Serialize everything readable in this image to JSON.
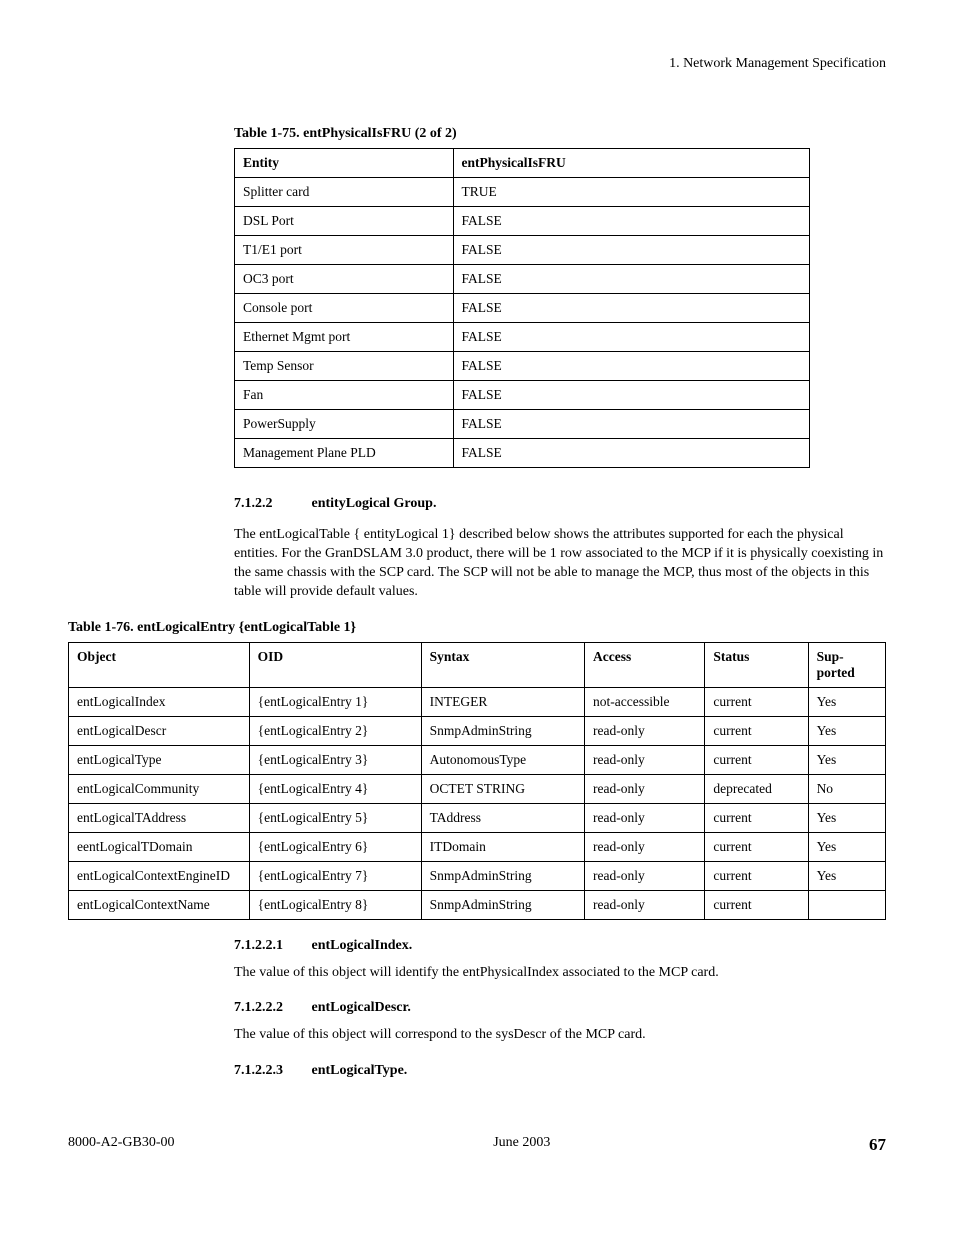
{
  "header": {
    "chapter": "1. Network Management Specification"
  },
  "table175": {
    "caption": "Table 1-75.  entPhysicalIsFRU (2 of 2)",
    "headers": [
      "Entity",
      "entPhysicalIsFRU"
    ],
    "rows": [
      [
        "Splitter card",
        "TRUE"
      ],
      [
        "DSL Port",
        "FALSE"
      ],
      [
        "T1/E1 port",
        "FALSE"
      ],
      [
        "OC3 port",
        "FALSE"
      ],
      [
        "Console port",
        "FALSE"
      ],
      [
        "Ethernet Mgmt port",
        "FALSE"
      ],
      [
        "Temp Sensor",
        "FALSE"
      ],
      [
        "Fan",
        "FALSE"
      ],
      [
        "PowerSupply",
        "FALSE"
      ],
      [
        "Management Plane PLD",
        "FALSE"
      ]
    ]
  },
  "section7122": {
    "number": "7.1.2.2",
    "title": "entityLogical Group.",
    "body": "The entLogicalTable { entityLogical 1} described below shows the attributes supported for each the physical entities. For the GranDSLAM 3.0 product, there will be 1 row associated to the MCP if it is physically coexisting in the same chassis with the SCP card. The SCP will not be able to manage the MCP, thus most of the objects in this table will provide default values."
  },
  "table176": {
    "caption": "Table 1-76.  entLogicalEntry {entLogicalTable 1}",
    "headers": [
      "Object",
      "OID",
      "Syntax",
      "Access",
      "Status",
      "Sup-ported"
    ],
    "rows": [
      [
        "entLogicalIndex",
        "{entLogicalEntry 1}",
        "INTEGER",
        "not-accessible",
        "current",
        "Yes"
      ],
      [
        "entLogicalDescr",
        "{entLogicalEntry 2}",
        "SnmpAdminString",
        "read-only",
        "current",
        "Yes"
      ],
      [
        "entLogicalType",
        "{entLogicalEntry 3}",
        "AutonomousType",
        "read-only",
        "current",
        "Yes"
      ],
      [
        "entLogicalCommunity",
        "{entLogicalEntry 4}",
        "OCTET STRING",
        "read-only",
        "deprecated",
        "No"
      ],
      [
        "entLogicalTAddress",
        "{entLogicalEntry 5}",
        "TAddress",
        "read-only",
        "current",
        "Yes"
      ],
      [
        "eentLogicalTDomain",
        "{entLogicalEntry 6}",
        "ITDomain",
        "read-only",
        "current",
        "Yes"
      ],
      [
        "entLogicalContextEngineID",
        "{entLogicalEntry 7}",
        "SnmpAdminString",
        "read-only",
        "current",
        "Yes"
      ],
      [
        "entLogicalContextName",
        "{entLogicalEntry 8}",
        "SnmpAdminString",
        "read-only",
        "current",
        ""
      ]
    ]
  },
  "sub1": {
    "number": "7.1.2.2.1",
    "title": "entLogicalIndex.",
    "body": "The value of this object will identify the entPhysicalIndex associated to the MCP card."
  },
  "sub2": {
    "number": "7.1.2.2.2",
    "title": "entLogicalDescr.",
    "body": "The value of this object will correspond to the sysDescr of the MCP card."
  },
  "sub3": {
    "number": "7.1.2.2.3",
    "title": "entLogicalType."
  },
  "footer": {
    "doc": "8000-A2-GB30-00",
    "date": "June 2003",
    "page": "67"
  }
}
